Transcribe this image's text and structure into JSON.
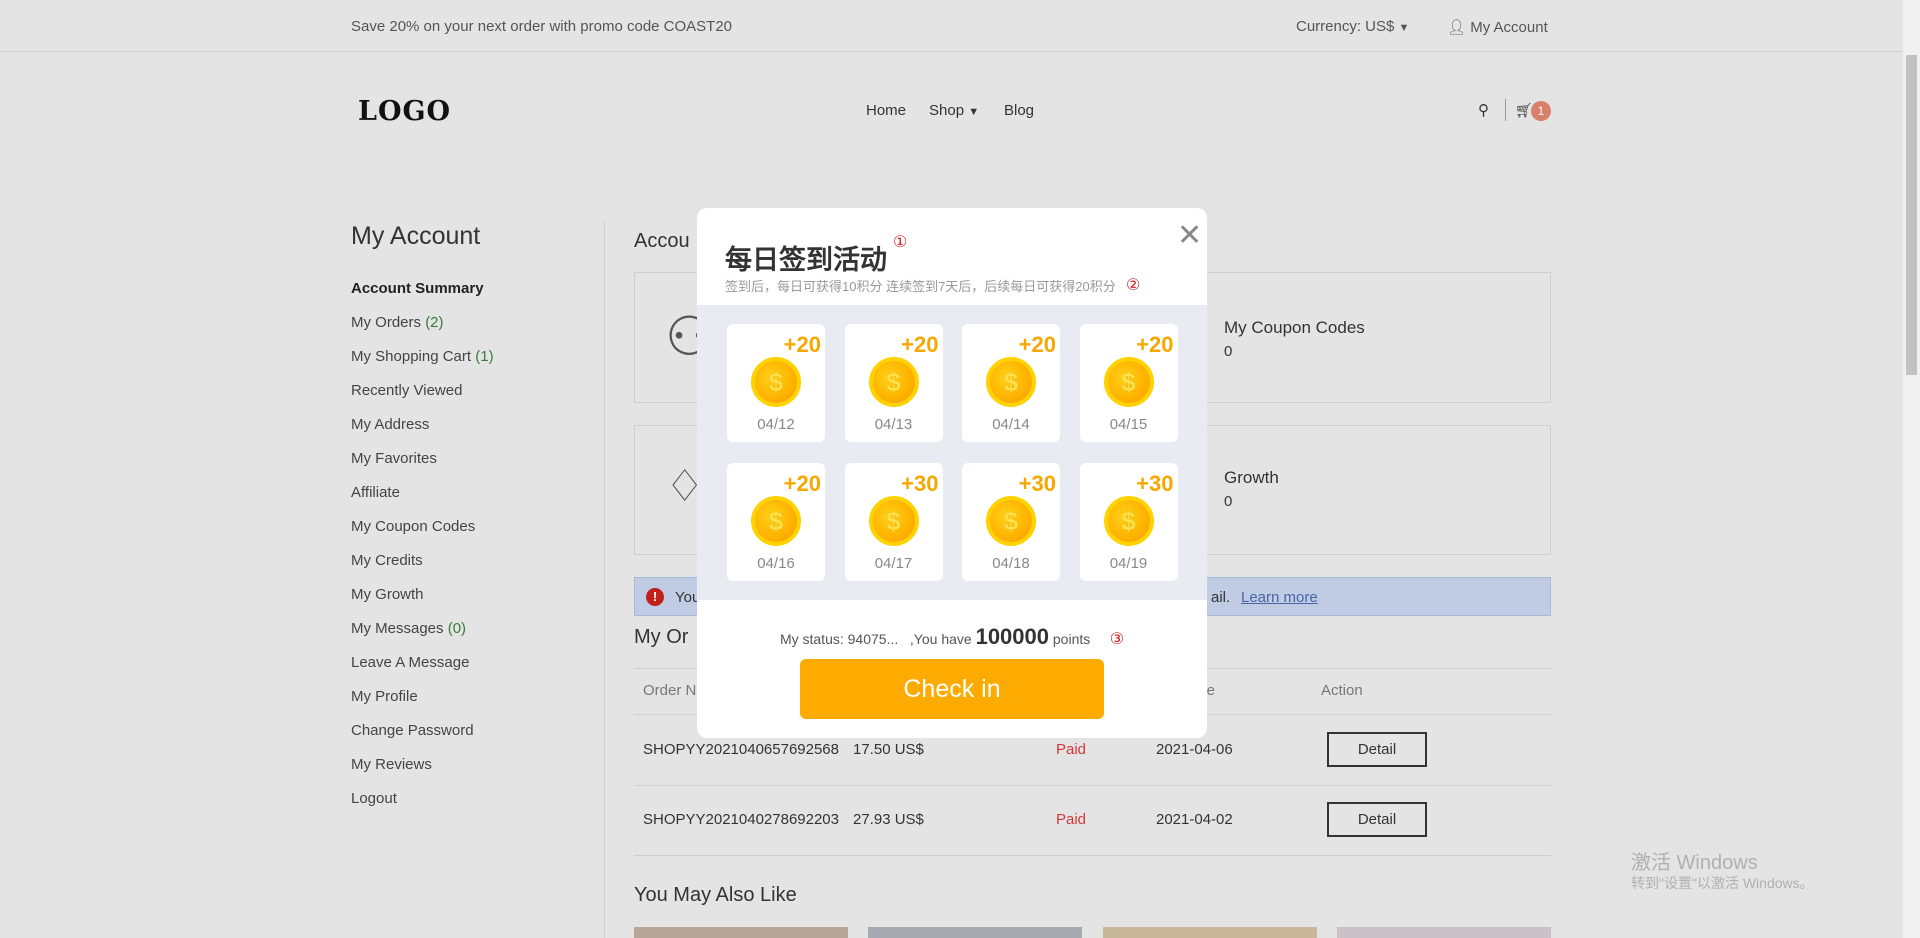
{
  "topbar": {
    "promo": "Save 20% on your next order with promo code COAST20",
    "currency": "Currency: US$",
    "account": "My Account"
  },
  "header": {
    "logo": "LOGO",
    "nav": [
      "Home",
      "Shop",
      "Blog"
    ],
    "cart_count": "1"
  },
  "sidebar": {
    "title": "My Account",
    "items": [
      {
        "label": "Account Summary",
        "count": ""
      },
      {
        "label": "My Orders",
        "count": "(2)"
      },
      {
        "label": "My Shopping Cart",
        "count": "(1)"
      },
      {
        "label": "Recently Viewed",
        "count": ""
      },
      {
        "label": "My Address",
        "count": ""
      },
      {
        "label": "My Favorites",
        "count": ""
      },
      {
        "label": "Affiliate",
        "count": ""
      },
      {
        "label": "My Coupon Codes",
        "count": ""
      },
      {
        "label": "My Credits",
        "count": ""
      },
      {
        "label": "My Growth",
        "count": ""
      },
      {
        "label": "My Messages",
        "count": "(0)"
      },
      {
        "label": "Leave A Message",
        "count": ""
      },
      {
        "label": "My Profile",
        "count": ""
      },
      {
        "label": "Change Password",
        "count": ""
      },
      {
        "label": "My Reviews",
        "count": ""
      },
      {
        "label": "Logout",
        "count": ""
      }
    ]
  },
  "main": {
    "title": "Accou",
    "boxes": [
      {
        "label": "My Coupon Codes",
        "value": "0"
      },
      {
        "label": "Growth",
        "value": "0"
      }
    ],
    "alert": {
      "text_left": "You",
      "text_right": "ail.",
      "link": "Learn more"
    },
    "orders_title": "My Or",
    "columns": [
      "Order N",
      "n Time",
      "Action"
    ],
    "orders": [
      {
        "no": "SHOPYY2021040657692568",
        "price": "17.50 US$",
        "status": "Paid",
        "time": "2021-04-06",
        "action": "Detail"
      },
      {
        "no": "SHOPYY2021040278692203",
        "price": "27.93 US$",
        "status": "Paid",
        "time": "2021-04-02",
        "action": "Detail"
      }
    ],
    "also_like": "You May Also Like"
  },
  "modal": {
    "title": "每日签到活动",
    "marker1": "①",
    "subtitle": "签到后，每日可获得10积分 连续签到7天后，后续每日可获得20积分",
    "marker2": "②",
    "days": [
      {
        "points": "+20",
        "date": "04/12"
      },
      {
        "points": "+20",
        "date": "04/13"
      },
      {
        "points": "+20",
        "date": "04/14"
      },
      {
        "points": "+20",
        "date": "04/15"
      },
      {
        "points": "+20",
        "date": "04/16"
      },
      {
        "points": "+30",
        "date": "04/17"
      },
      {
        "points": "+30",
        "date": "04/18"
      },
      {
        "points": "+30",
        "date": "04/19"
      }
    ],
    "coin_symbol": "$",
    "status_label": "My status: 94075...",
    "have_label": ",You have",
    "points": "100000",
    "points_unit": "points",
    "marker3": "③",
    "checkin": "Check in"
  },
  "watermark": {
    "line1": "激活 Windows",
    "line2": "转到\"设置\"以激活 Windows。"
  },
  "colors": {
    "accent": "#fdab00",
    "paid": "#d0393b",
    "alert_bg": "#bfcce4"
  }
}
